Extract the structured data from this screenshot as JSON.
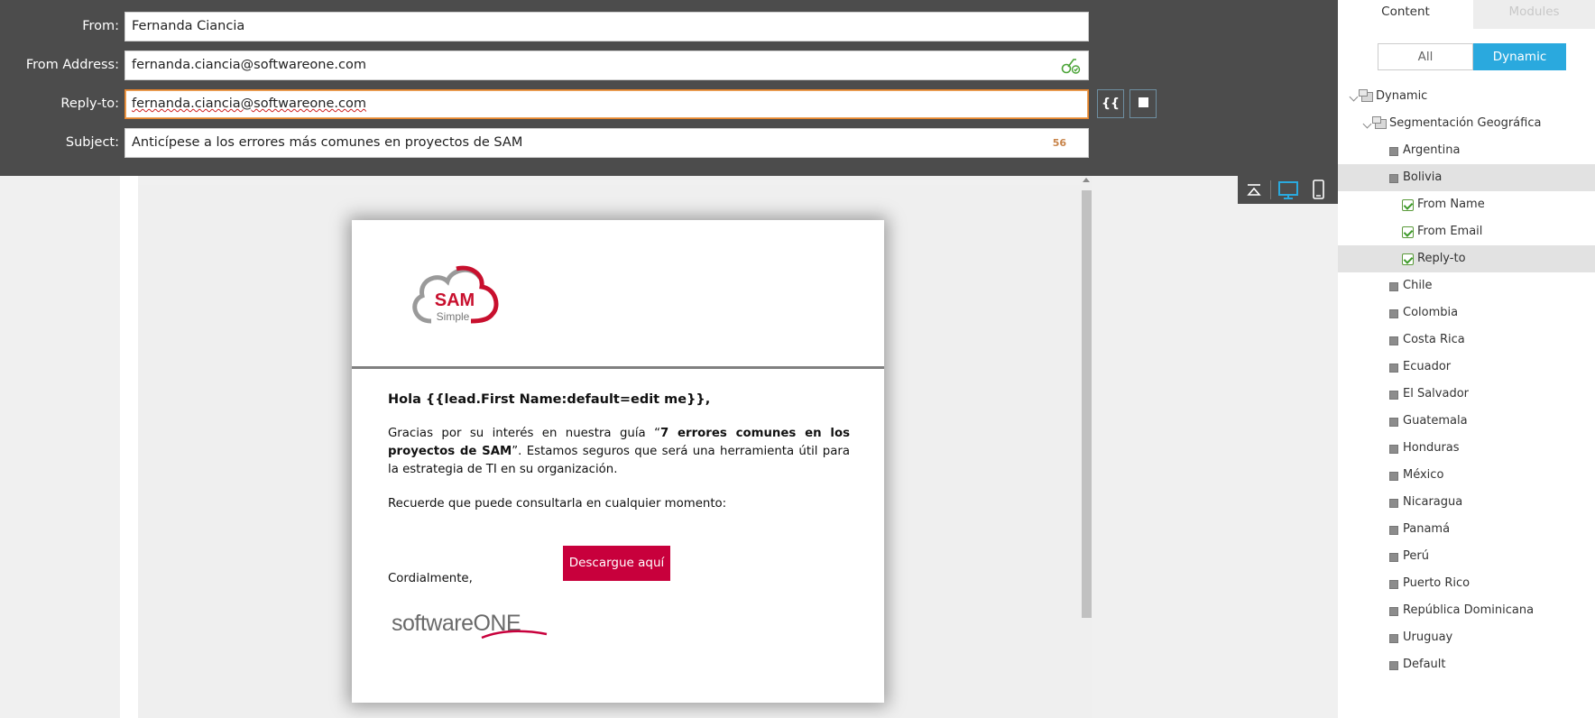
{
  "header": {
    "from_label": "From:",
    "from_value": "Fernanda Ciancia",
    "address_label": "From Address:",
    "address_value": "fernanda.ciancia@softwareone.com",
    "reply_label": "Reply-to:",
    "reply_value": "fernanda.ciancia@softwareone.com",
    "subject_label": "Subject:",
    "subject_value": "Anticípese a los errores más comunes en proyectos de SAM",
    "subject_count": "56",
    "token_button": "{{"
  },
  "email": {
    "logo_text_main": "SAM",
    "logo_text_sub": "Simple",
    "greeting": "Hola {{lead.First Name:default=edit me}},",
    "para1_pre": "Gracias por su interés en nuestra guía “",
    "para1_bold": "7 errores comunes en los proyectos de SAM",
    "para1_post": "”. Estamos seguros que será una herramienta útil para la estrategia de TI en su organización.",
    "para2": "Recuerde que puede consultarla en cualquier momento:",
    "cta": "Descargue aquí",
    "signoff": "Cordialmente,",
    "footer_logo": "softwareONE"
  },
  "panel": {
    "tab_content": "Content",
    "tab_modules": "Modules",
    "seg_all": "All",
    "seg_dynamic": "Dynamic",
    "tree": {
      "root": "Dynamic",
      "segmentation": "Segmentación Geográfica",
      "countries": [
        "Argentina",
        "Bolivia",
        "Chile",
        "Colombia",
        "Costa Rica",
        "Ecuador",
        "El Salvador",
        "Guatemala",
        "Honduras",
        "México",
        "Nicaragua",
        "Panamá",
        "Perú",
        "Puerto Rico",
        "República Dominicana",
        "Uruguay",
        "Default"
      ],
      "bolivia_children": [
        "From Name",
        "From Email",
        "Reply-to"
      ]
    }
  },
  "colors": {
    "header_bg": "#4c4c4c",
    "accent_blue": "#2aa9de",
    "cta_red": "#c8003c",
    "focus_orange": "#e8832a"
  }
}
